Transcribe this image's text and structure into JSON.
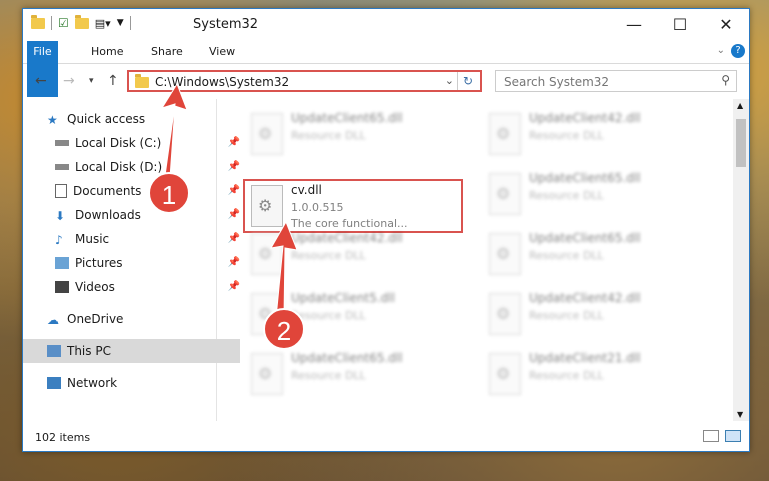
{
  "window": {
    "title": "System32"
  },
  "ribbon": {
    "tabs": [
      "File",
      "Home",
      "Share",
      "View"
    ]
  },
  "address": {
    "path": "C:\\Windows\\System32",
    "refresh_label": "↻"
  },
  "search": {
    "placeholder": "Search System32"
  },
  "nav": {
    "items": [
      {
        "label": "Quick access"
      },
      {
        "label": "Local Disk (C:)"
      },
      {
        "label": "Local Disk (D:)"
      },
      {
        "label": "Documents"
      },
      {
        "label": "Downloads"
      },
      {
        "label": "Music"
      },
      {
        "label": "Pictures"
      },
      {
        "label": "Videos"
      },
      {
        "label": "OneDrive"
      },
      {
        "label": "This PC"
      },
      {
        "label": "Network"
      }
    ]
  },
  "files": {
    "highlight": {
      "name": "cv.dll",
      "version": "1.0.0.515",
      "desc": "The core functional..."
    },
    "items": [
      {
        "name": "UpdateClient65.dll",
        "desc": "Resource DLL"
      },
      {
        "name": "UpdateClient42.dll",
        "desc": "Resource DLL"
      },
      {
        "name": "UpdateClient65.dll",
        "desc": "Resource DLL"
      },
      {
        "name": "UpdateClient42.dll",
        "desc": "Resource DLL"
      },
      {
        "name": "UpdateClient65.dll",
        "desc": "Resource DLL"
      },
      {
        "name": "UpdateClient5.dll",
        "desc": "Resource DLL"
      },
      {
        "name": "UpdateClient42.dll",
        "desc": "Resource DLL"
      },
      {
        "name": "UpdateClient65.dll",
        "desc": "Resource DLL"
      },
      {
        "name": "UpdateClient21.dll",
        "desc": "Resource DLL"
      }
    ]
  },
  "status": {
    "count": "102 items"
  },
  "annotations": {
    "badge1": "1",
    "badge2": "2"
  },
  "colors": {
    "accent": "#1979ca",
    "highlight": "#d9534f",
    "arrow": "#e0453a"
  }
}
